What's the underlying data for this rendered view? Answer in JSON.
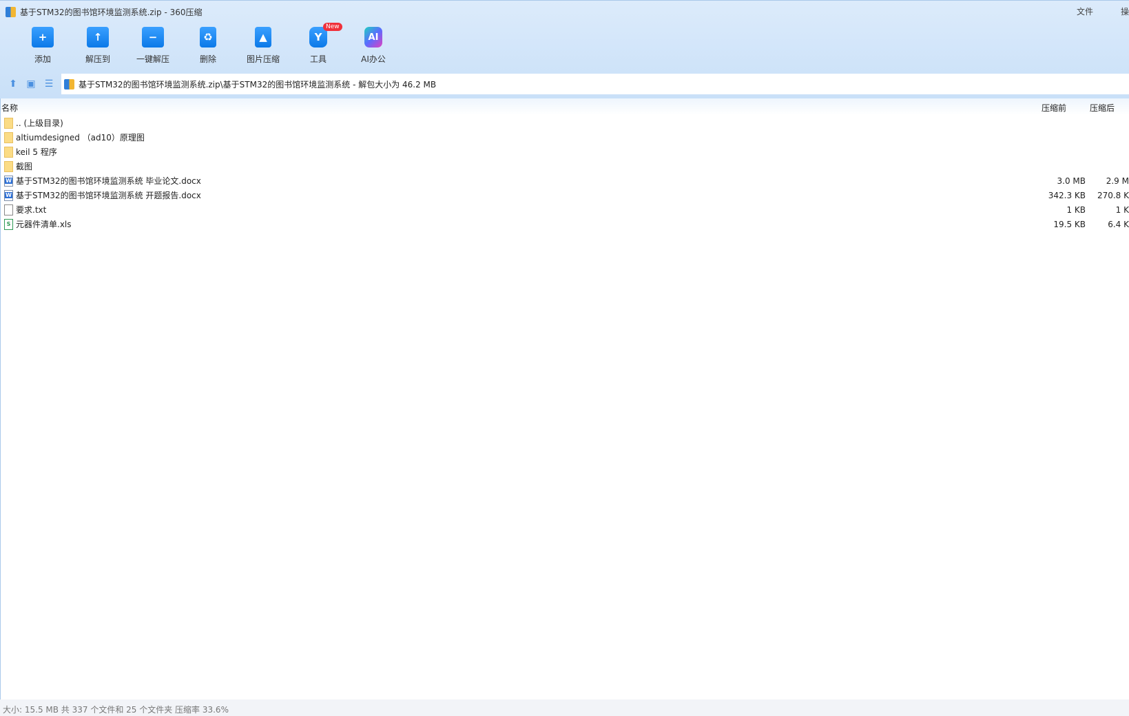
{
  "window": {
    "title": "基于STM32的图书馆环境监测系统.zip - 360压缩",
    "menu": [
      "文件",
      "操"
    ]
  },
  "toolbar": [
    {
      "label": "添加",
      "icon": "+"
    },
    {
      "label": "解压到",
      "icon": "↑"
    },
    {
      "label": "一键解压",
      "icon": "−"
    },
    {
      "label": "删除",
      "icon": "♻"
    },
    {
      "label": "图片压缩",
      "icon": "▲"
    },
    {
      "label": "工具",
      "icon": "Y",
      "badge": "New"
    },
    {
      "label": "AI办公",
      "icon": "AI"
    }
  ],
  "address": "基于STM32的图书馆环境监测系统.zip\\基于STM32的图书馆环境监测系统 - 解包大小为 46.2 MB",
  "columns": {
    "name": "名称",
    "before": "压缩前",
    "after": "压缩后"
  },
  "files": [
    {
      "name": ".. (上级目录)",
      "type": "folder",
      "before": "",
      "after": ""
    },
    {
      "name": "altiumdesigned （ad10）原理图",
      "type": "folder",
      "before": "",
      "after": ""
    },
    {
      "name": "keil 5 程序",
      "type": "folder",
      "before": "",
      "after": ""
    },
    {
      "name": "截图",
      "type": "folder",
      "before": "",
      "after": ""
    },
    {
      "name": "基于STM32的图书馆环境监测系统 毕业论文.docx",
      "type": "word",
      "before": "3.0 MB",
      "after": "2.9 M"
    },
    {
      "name": "基于STM32的图书馆环境监测系统 开题报告.docx",
      "type": "word",
      "before": "342.3 KB",
      "after": "270.8 K"
    },
    {
      "name": "要求.txt",
      "type": "txt",
      "before": "1 KB",
      "after": "1 K"
    },
    {
      "name": "元器件清单.xls",
      "type": "xls",
      "before": "19.5 KB",
      "after": "6.4 K"
    }
  ],
  "status": "大小: 15.5 MB 共 337 个文件和 25 个文件夹 压缩率 33.6%"
}
